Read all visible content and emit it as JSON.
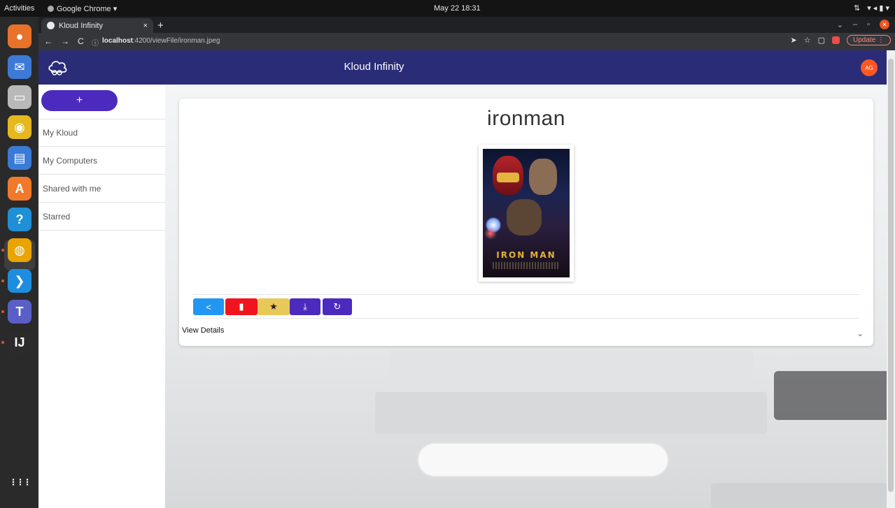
{
  "os": {
    "activities_label": "Activities",
    "app_menu_label": "Google Chrome ▾",
    "clock": "May 22  18:31",
    "tray": [
      "⇅",
      "▾ ◂ ▮ ▾"
    ],
    "dock_apps": [
      {
        "name": "firefox-icon",
        "glyph": "●",
        "color": "#e8722a"
      },
      {
        "name": "thunderbird-icon",
        "glyph": "✉",
        "color": "#3d7ad6"
      },
      {
        "name": "files-icon",
        "glyph": "▭",
        "color": "#b9b9b9"
      },
      {
        "name": "rhythmbox-icon",
        "glyph": "◉",
        "color": "#e6b81f"
      },
      {
        "name": "libreoffice-writer-icon",
        "glyph": "▤",
        "color": "#3a7bd5"
      },
      {
        "name": "software-center-icon",
        "glyph": "A",
        "color": "#f0792c"
      },
      {
        "name": "help-icon",
        "glyph": "?",
        "color": "#1f8fd6"
      },
      {
        "name": "chrome-icon",
        "glyph": "◍",
        "color": "#e9a400"
      },
      {
        "name": "vscode-icon",
        "glyph": "❯",
        "color": "#1e8ddf"
      },
      {
        "name": "teams-icon",
        "glyph": "T",
        "color": "#5a5fc7"
      },
      {
        "name": "intellij-icon",
        "glyph": "IJ",
        "color": "#2b2b2b"
      },
      {
        "name": "app-grid-icon",
        "glyph": "⋮⋮⋮",
        "color": "transparent"
      }
    ]
  },
  "browser": {
    "tab_title": "Kloud Infinity",
    "tab_close": "×",
    "new_tab": "+",
    "url_host": "localhost",
    "url_path": ":4200/viewFile/ironman.jpeg",
    "update_label": "Update"
  },
  "app": {
    "title": "Kloud Infinity",
    "avatar_initials": "AG",
    "fab_label": "+",
    "nav": [
      "My Kloud",
      "My Computers",
      "Shared with me",
      "Starred"
    ],
    "file_name": "ironman",
    "poster_title": "IRON MAN",
    "actions": [
      {
        "name": "share-button",
        "glyph": "<",
        "label": "share"
      },
      {
        "name": "delete-button",
        "glyph": "▮",
        "label": "delete"
      },
      {
        "name": "star-button",
        "glyph": "★",
        "label": "star"
      },
      {
        "name": "download-button",
        "glyph": "⤓",
        "label": "download"
      },
      {
        "name": "restore-button",
        "glyph": "↻",
        "label": "restore"
      }
    ],
    "details_label": "View Details",
    "details_chevron": "⌄"
  }
}
